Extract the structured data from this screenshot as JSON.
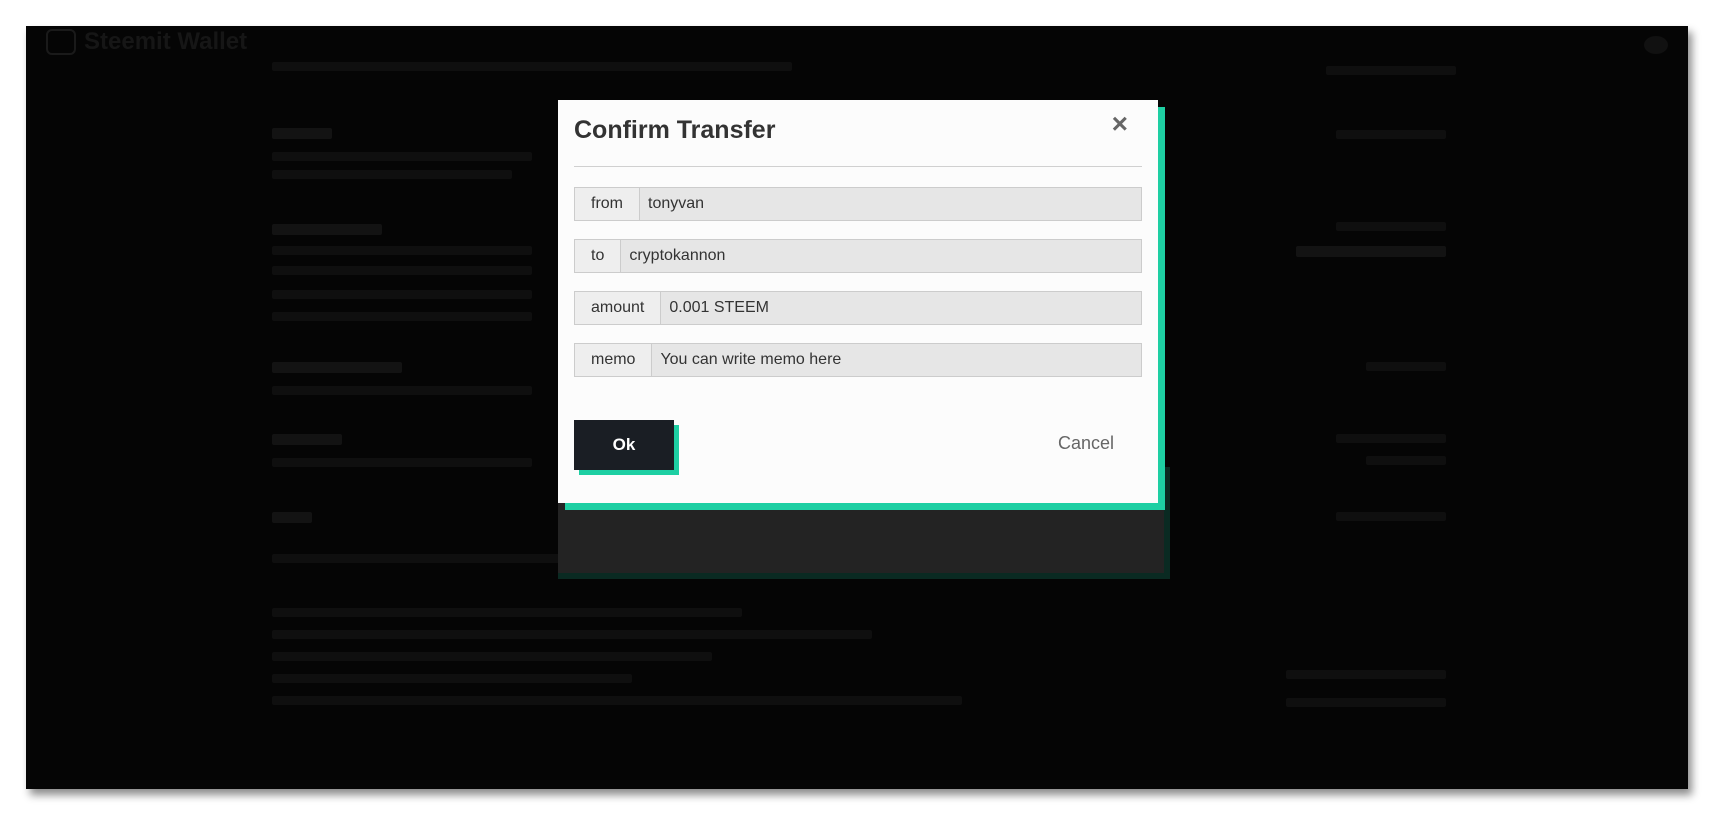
{
  "app": {
    "logo_text": "Steemit Wallet"
  },
  "modal": {
    "title": "Confirm Transfer",
    "close_glyph": "×",
    "fields": [
      {
        "label": "from",
        "value": "tonyvan"
      },
      {
        "label": "to",
        "value": "cryptokannon"
      },
      {
        "label": "amount",
        "value": "0.001 STEEM"
      },
      {
        "label": "memo",
        "value": "",
        "placeholder": "You can write memo here"
      }
    ],
    "ok_label": "Ok",
    "cancel_label": "Cancel"
  },
  "colors": {
    "accent": "#1ecfa3",
    "ok_button": "#1a1e24",
    "overlay": "#050505"
  }
}
